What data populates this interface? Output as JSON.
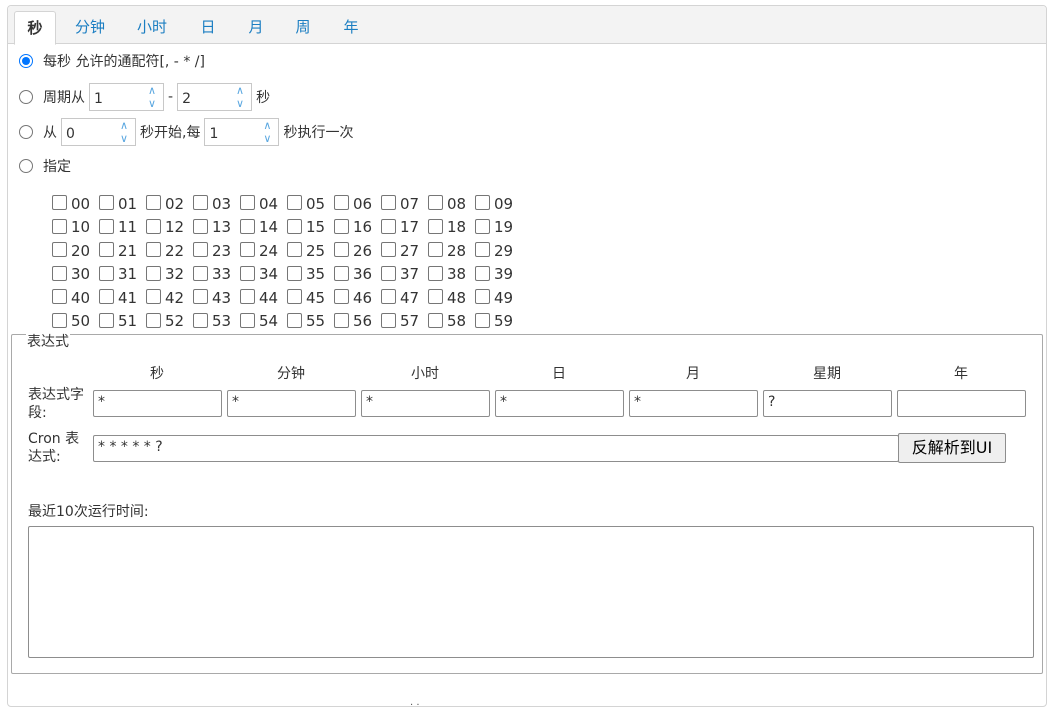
{
  "tabs": [
    {
      "label": "秒",
      "active": true
    },
    {
      "label": "分钟",
      "active": false
    },
    {
      "label": "小时",
      "active": false
    },
    {
      "label": "日",
      "active": false
    },
    {
      "label": "月",
      "active": false
    },
    {
      "label": "周",
      "active": false
    },
    {
      "label": "年",
      "active": false
    }
  ],
  "options": {
    "every": {
      "label": "每秒 允许的通配符[, - * /]",
      "checked": true
    },
    "cycle": {
      "label_from": "周期从",
      "from": "1",
      "dash": "-",
      "to": "2",
      "unit": "秒",
      "checked": false
    },
    "interval": {
      "label_from": "从",
      "start": "0",
      "mid": "秒开始,每",
      "every": "1",
      "end": "秒执行一次",
      "checked": false
    },
    "specify": {
      "label": "指定",
      "checked": false
    }
  },
  "seconds_grid": [
    [
      "00",
      "01",
      "02",
      "03",
      "04",
      "05",
      "06",
      "07",
      "08",
      "09"
    ],
    [
      "10",
      "11",
      "12",
      "13",
      "14",
      "15",
      "16",
      "17",
      "18",
      "19"
    ],
    [
      "20",
      "21",
      "22",
      "23",
      "24",
      "25",
      "26",
      "27",
      "28",
      "29"
    ],
    [
      "30",
      "31",
      "32",
      "33",
      "34",
      "35",
      "36",
      "37",
      "38",
      "39"
    ],
    [
      "40",
      "41",
      "42",
      "43",
      "44",
      "45",
      "46",
      "47",
      "48",
      "49"
    ],
    [
      "50",
      "51",
      "52",
      "53",
      "54",
      "55",
      "56",
      "57",
      "58",
      "59"
    ]
  ],
  "expression": {
    "legend": "表达式",
    "columns": [
      "秒",
      "分钟",
      "小时",
      "日",
      "月",
      "星期",
      "年"
    ],
    "field_label": "表达式字段:",
    "fields": [
      "*",
      "*",
      "*",
      "*",
      "*",
      "?",
      ""
    ],
    "cron_label": "Cron 表达式:",
    "cron_value": "* * * * * ?",
    "parse_button": "反解析到UI",
    "recent_label": "最近10次运行时间:",
    "recent_value": ""
  },
  "footer": "· ·"
}
